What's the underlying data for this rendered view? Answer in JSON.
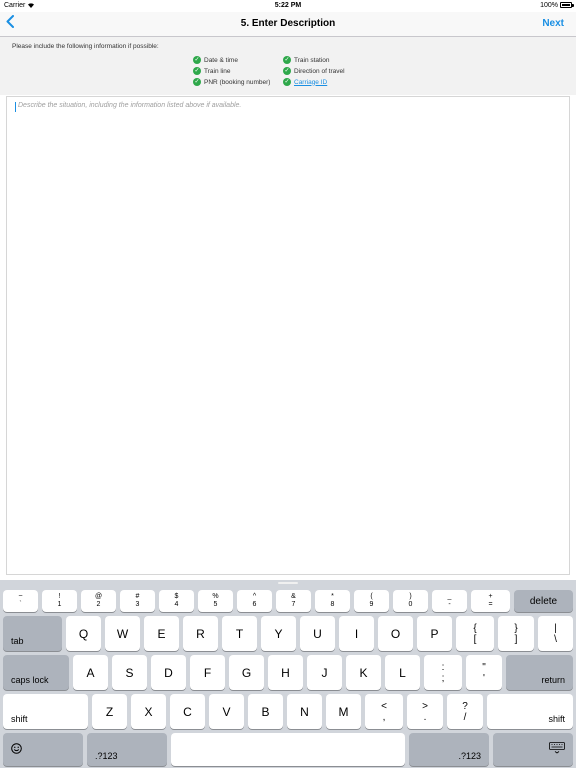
{
  "status_bar": {
    "carrier": "Carrier",
    "time": "5:22 PM",
    "battery": "100%"
  },
  "nav": {
    "back_icon": "chevron-left",
    "title": "5. Enter Description",
    "next": "Next"
  },
  "info": {
    "intro": "Please include the following information if possible:",
    "items_left": [
      "Date & time",
      "Train line",
      "PNR (booking number)"
    ],
    "items_right": [
      "Train station",
      "Direction of travel",
      "Carriage ID"
    ]
  },
  "description": {
    "placeholder": "Describe the situation, including the information listed above if available."
  },
  "keyboard": {
    "number_row": [
      [
        "~",
        "`"
      ],
      [
        "!",
        "1"
      ],
      [
        "@",
        "2"
      ],
      [
        "#",
        "3"
      ],
      [
        "$",
        "4"
      ],
      [
        "%",
        "5"
      ],
      [
        "^",
        "6"
      ],
      [
        "&",
        "7"
      ],
      [
        "*",
        "8"
      ],
      [
        "(",
        "9"
      ],
      [
        ")",
        "0"
      ],
      [
        "_",
        "-"
      ],
      [
        "+",
        "="
      ]
    ],
    "delete": "delete",
    "tab": "tab",
    "row_q": [
      "Q",
      "W",
      "E",
      "R",
      "T",
      "Y",
      "U",
      "I",
      "O",
      "P"
    ],
    "row_q_syms": [
      [
        "{",
        "["
      ],
      [
        "}",
        "]"
      ],
      [
        "|",
        "\\"
      ]
    ],
    "caps_lock": "caps lock",
    "row_a": [
      "A",
      "S",
      "D",
      "F",
      "G",
      "H",
      "J",
      "K",
      "L"
    ],
    "row_a_syms": [
      [
        ":",
        ";"
      ],
      [
        "\"",
        "'"
      ]
    ],
    "return": "return",
    "shift": "shift",
    "row_z": [
      "Z",
      "X",
      "C",
      "V",
      "B",
      "N",
      "M"
    ],
    "row_z_syms": [
      [
        "<",
        ","
      ],
      [
        ">",
        "."
      ],
      [
        "?",
        "/"
      ]
    ],
    "numbers_key": ".?123",
    "emoji_icon": "emoji-icon",
    "dismiss_icon": "keyboard-dismiss-icon"
  }
}
